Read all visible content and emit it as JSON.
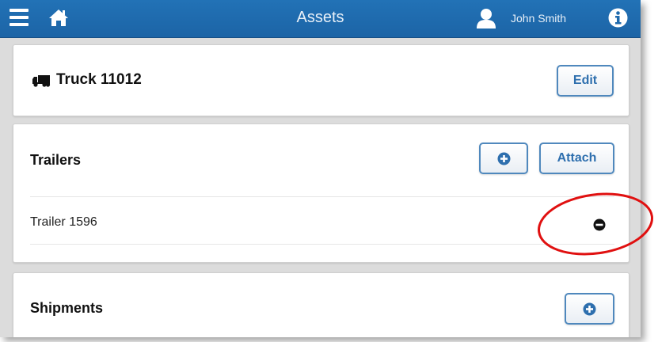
{
  "header": {
    "title": "Assets",
    "user_name": "John Smith",
    "icons": {
      "menu": "hamburger-menu-icon",
      "home": "home-icon",
      "user": "user-icon",
      "info": "info-icon"
    },
    "colors": {
      "bar": "#1f6aad",
      "text": "#ffffff"
    }
  },
  "truck": {
    "title": "Truck 11012",
    "icon": "truck-icon",
    "edit_label": "Edit"
  },
  "trailers": {
    "title": "Trailers",
    "attach_label": "Attach",
    "add_icon": "plus-circle-icon",
    "items": [
      {
        "label": "Trailer 1596",
        "remove_icon": "minus-circle-icon"
      }
    ]
  },
  "shipments": {
    "title": "Shipments",
    "add_icon": "plus-circle-icon"
  },
  "annotation": {
    "shape": "red-circle-highlight",
    "color": "#e01010"
  },
  "colors": {
    "accent": "#2e6fae",
    "button_border": "#4f88bd",
    "background": "#dcdcdc"
  }
}
